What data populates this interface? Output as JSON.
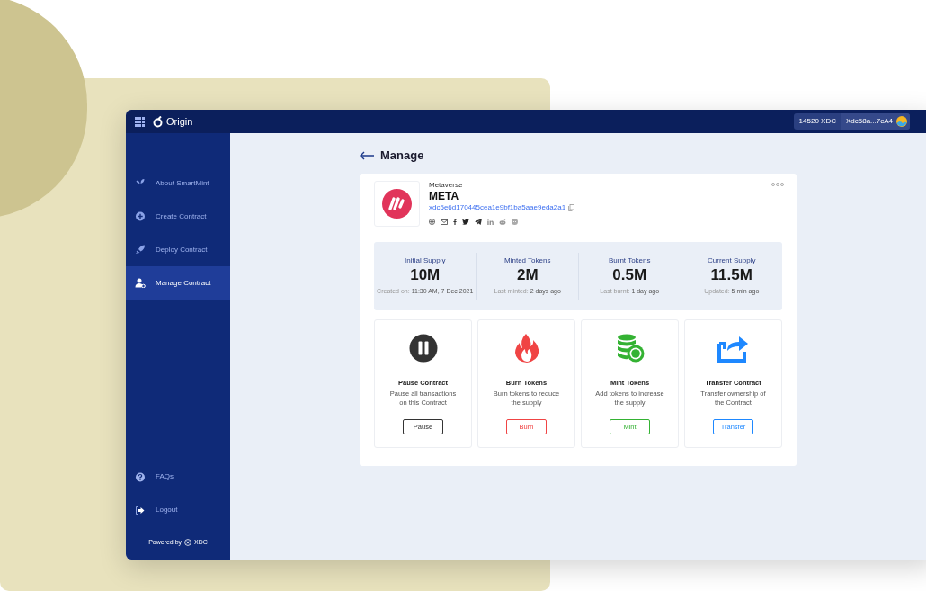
{
  "topbar": {
    "brand": "Origin",
    "balance": "14520 XDC",
    "address": "Xdc58a...7cA4"
  },
  "sidebar": {
    "items": [
      {
        "label": "About SmartMint",
        "selected": false
      },
      {
        "label": "Create Contract",
        "selected": false
      },
      {
        "label": "Deploy Contract",
        "selected": false
      },
      {
        "label": "Manage Contract",
        "selected": true
      }
    ],
    "bottom_items": [
      {
        "label": "FAQs"
      },
      {
        "label": "Logout"
      }
    ],
    "powered_by": "Powered by",
    "powered_brand": "XDC"
  },
  "page_title": "Manage",
  "token": {
    "category": "Metaverse",
    "symbol": "META",
    "address": "xdc5e6d170445cea1e9bf1ba5aae9eda2a1"
  },
  "stats": [
    {
      "label": "Initial Supply",
      "value": "10M",
      "note": "Created on: **11:30 AM, 7 Dec 2021**"
    },
    {
      "label": "Minted Tokens",
      "value": "2M",
      "note": "Last minted: **2 days ago**"
    },
    {
      "label": "Burnt Tokens",
      "value": "0.5M",
      "note": "Last burnt: **1 day ago**"
    },
    {
      "label": "Current Supply",
      "value": "11.5M",
      "note": "Updated: **5 min ago**"
    }
  ],
  "actions": [
    {
      "kind": "pause",
      "title": "Pause Contract",
      "description": "Pause all transactions on this Contract",
      "button": "Pause",
      "color": "#333333"
    },
    {
      "kind": "burn",
      "title": "Burn Tokens",
      "description": "Burn tokens to reduce the supply",
      "button": "Burn",
      "color": "#f04444"
    },
    {
      "kind": "mint",
      "title": "Mint Tokens",
      "description": "Add tokens to increase the supply",
      "button": "Mint",
      "color": "#34b233"
    },
    {
      "kind": "transfer",
      "title": "Transfer Contract",
      "description": "Transfer ownership of the Contract",
      "button": "Transfer",
      "color": "#1e88ff"
    }
  ]
}
